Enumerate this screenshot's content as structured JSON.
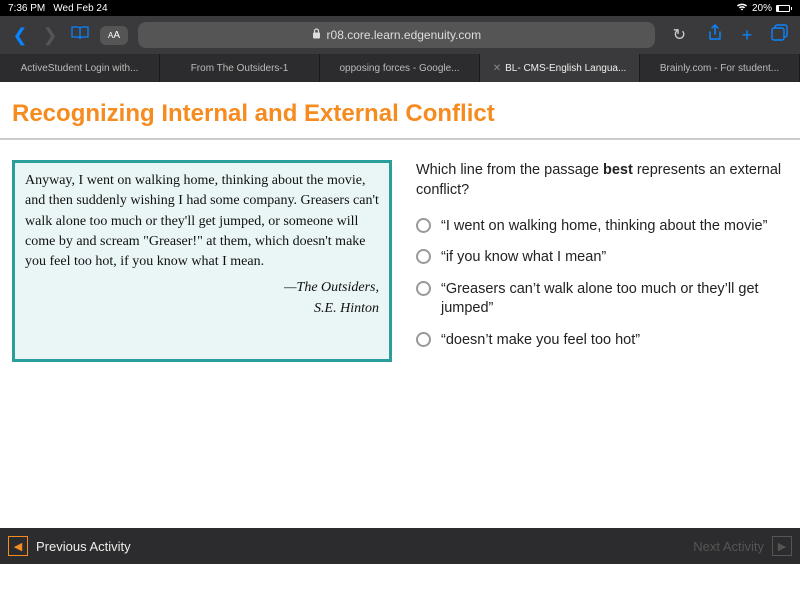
{
  "status": {
    "time": "7:36 PM",
    "date": "Wed Feb 24",
    "battery_pct": "20%"
  },
  "browser": {
    "text_size_label": "AA",
    "url": "r08.core.learn.edgenuity.com",
    "tabs": [
      {
        "label": "ActiveStudent Login with..."
      },
      {
        "label": "From The Outsiders-1"
      },
      {
        "label": "opposing forces - Google..."
      },
      {
        "label": "BL- CMS-English Langua..."
      },
      {
        "label": "Brainly.com - For student..."
      }
    ],
    "active_tab_index": 3
  },
  "page": {
    "title": "Recognizing Internal and External Conflict",
    "passage": "Anyway, I went on walking home, thinking about the movie, and then suddenly wishing I had some company. Greasers can't walk alone too much or they'll get jumped, or someone will come by and scream \"Greaser!\" at them, which doesn't make you feel too hot, if you know what I mean.",
    "attribution_work": "—The Outsiders,",
    "attribution_author": "S.E. Hinton",
    "question_pre": "Which line from the passage ",
    "question_bold": "best",
    "question_post": " represents an external conflict?",
    "options": [
      "“I went on walking home, thinking about the movie”",
      "“if you know what I mean”",
      "“Greasers can’t walk alone too much or they’ll get jumped”",
      "“doesn’t make you feel too hot”"
    ]
  },
  "footer": {
    "prev": "Previous Activity",
    "next": "Next Activity"
  }
}
